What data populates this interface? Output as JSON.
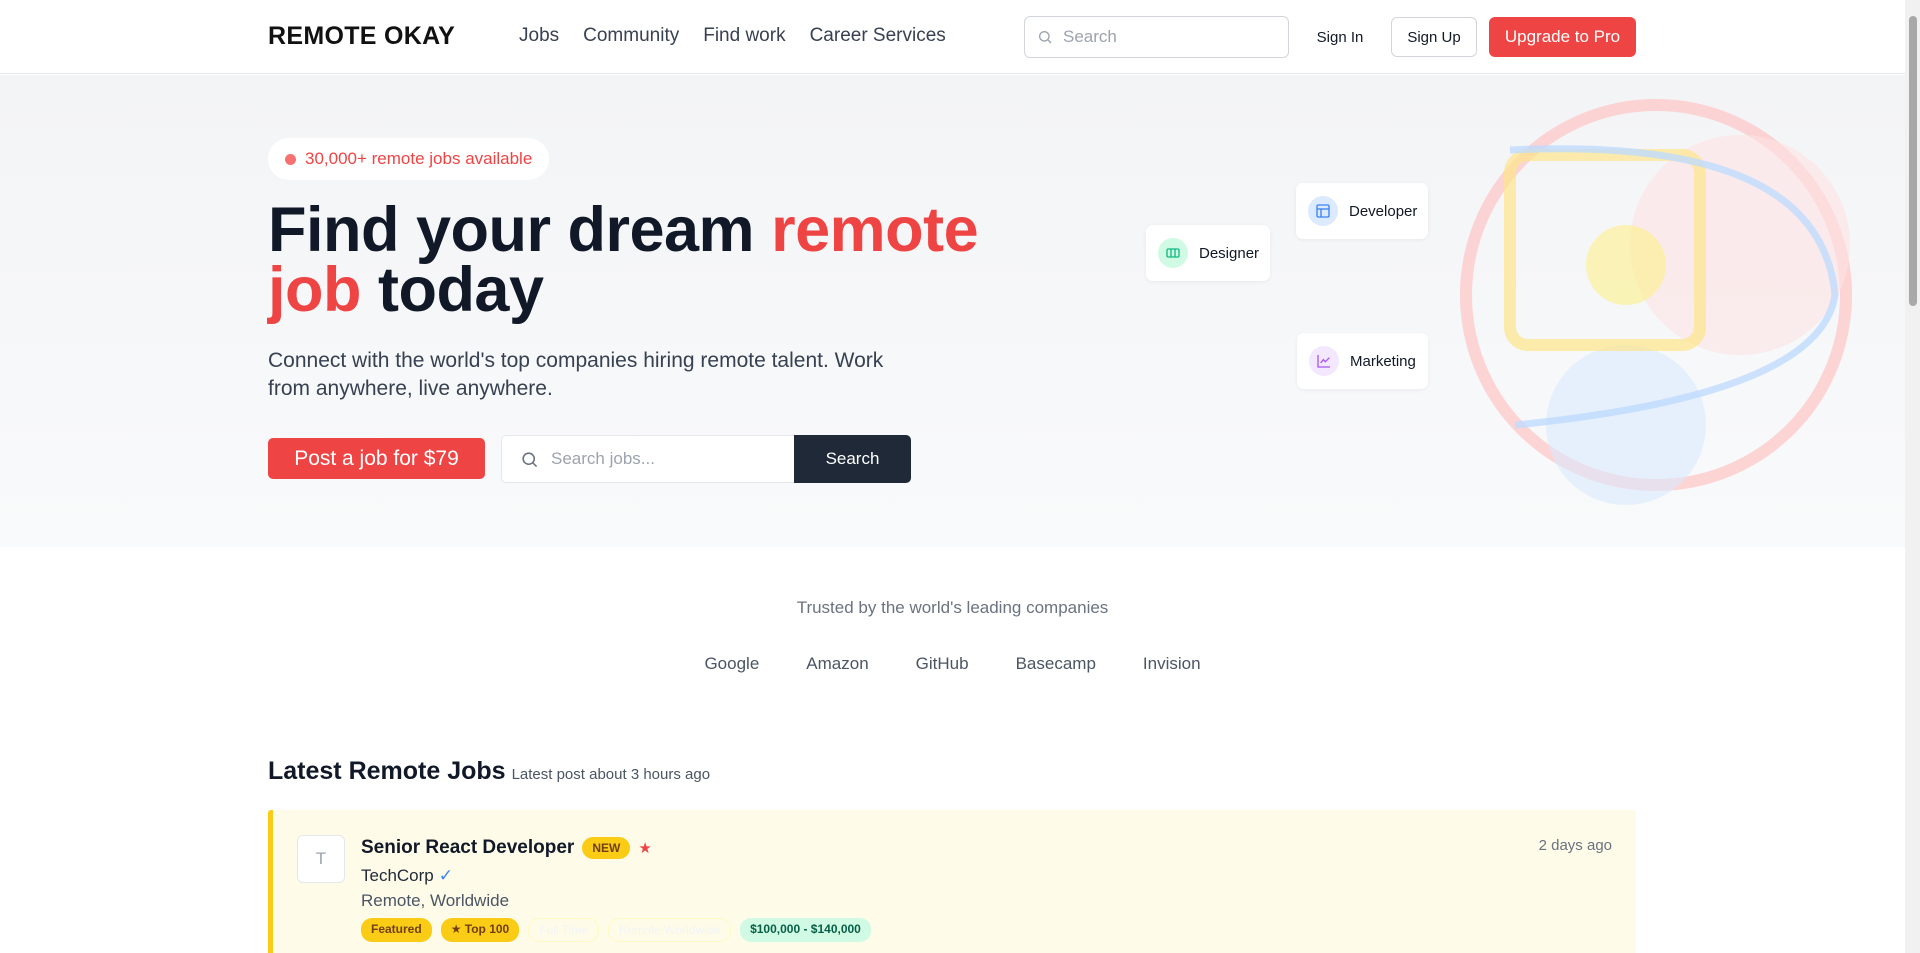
{
  "nav": {
    "brand": "REMOTE OKAY",
    "links": [
      "Jobs",
      "Community",
      "Find work",
      "Career Services"
    ],
    "search_placeholder": "Search",
    "sign_in": "Sign In",
    "sign_up": "Sign Up",
    "upgrade": "Upgrade to Pro"
  },
  "hero": {
    "pill": "30,000+ remote jobs available",
    "title_part1": "Find your dream ",
    "title_accent1": "remote",
    "title_accent2": "job",
    "title_part2": " today",
    "subtitle": "Connect with the world's top companies hiring remote talent. Work from anywhere, live anywhere.",
    "post_button": "Post a job for $79",
    "search_placeholder": "Search jobs...",
    "search_button": "Search",
    "categories": [
      {
        "label": "Developer",
        "icon": "layout-icon"
      },
      {
        "label": "Designer",
        "icon": "ticket-icon"
      },
      {
        "label": "Marketing",
        "icon": "chart-line-icon"
      }
    ]
  },
  "trusted": {
    "title": "Trusted by the world's leading companies",
    "companies": [
      "Google",
      "Amazon",
      "GitHub",
      "Basecamp",
      "Invision"
    ]
  },
  "latest": {
    "title": "Latest Remote Jobs",
    "subtitle": "Latest post about 3 hours ago",
    "jobs": [
      {
        "logo_letter": "T",
        "title": "Senior React Developer",
        "badge": "NEW",
        "company": "TechCorp",
        "location": "Remote, Worldwide",
        "time": "2 days ago",
        "tags": [
          "Featured",
          "★ Top 100",
          "Full Time",
          "Remote Worldwide",
          "$100,000 - $140,000"
        ]
      }
    ]
  },
  "colors": {
    "accent": "#ef4444",
    "dark": "#1f2937",
    "featured_bg": "#fefce8",
    "featured_border": "#facc15"
  }
}
